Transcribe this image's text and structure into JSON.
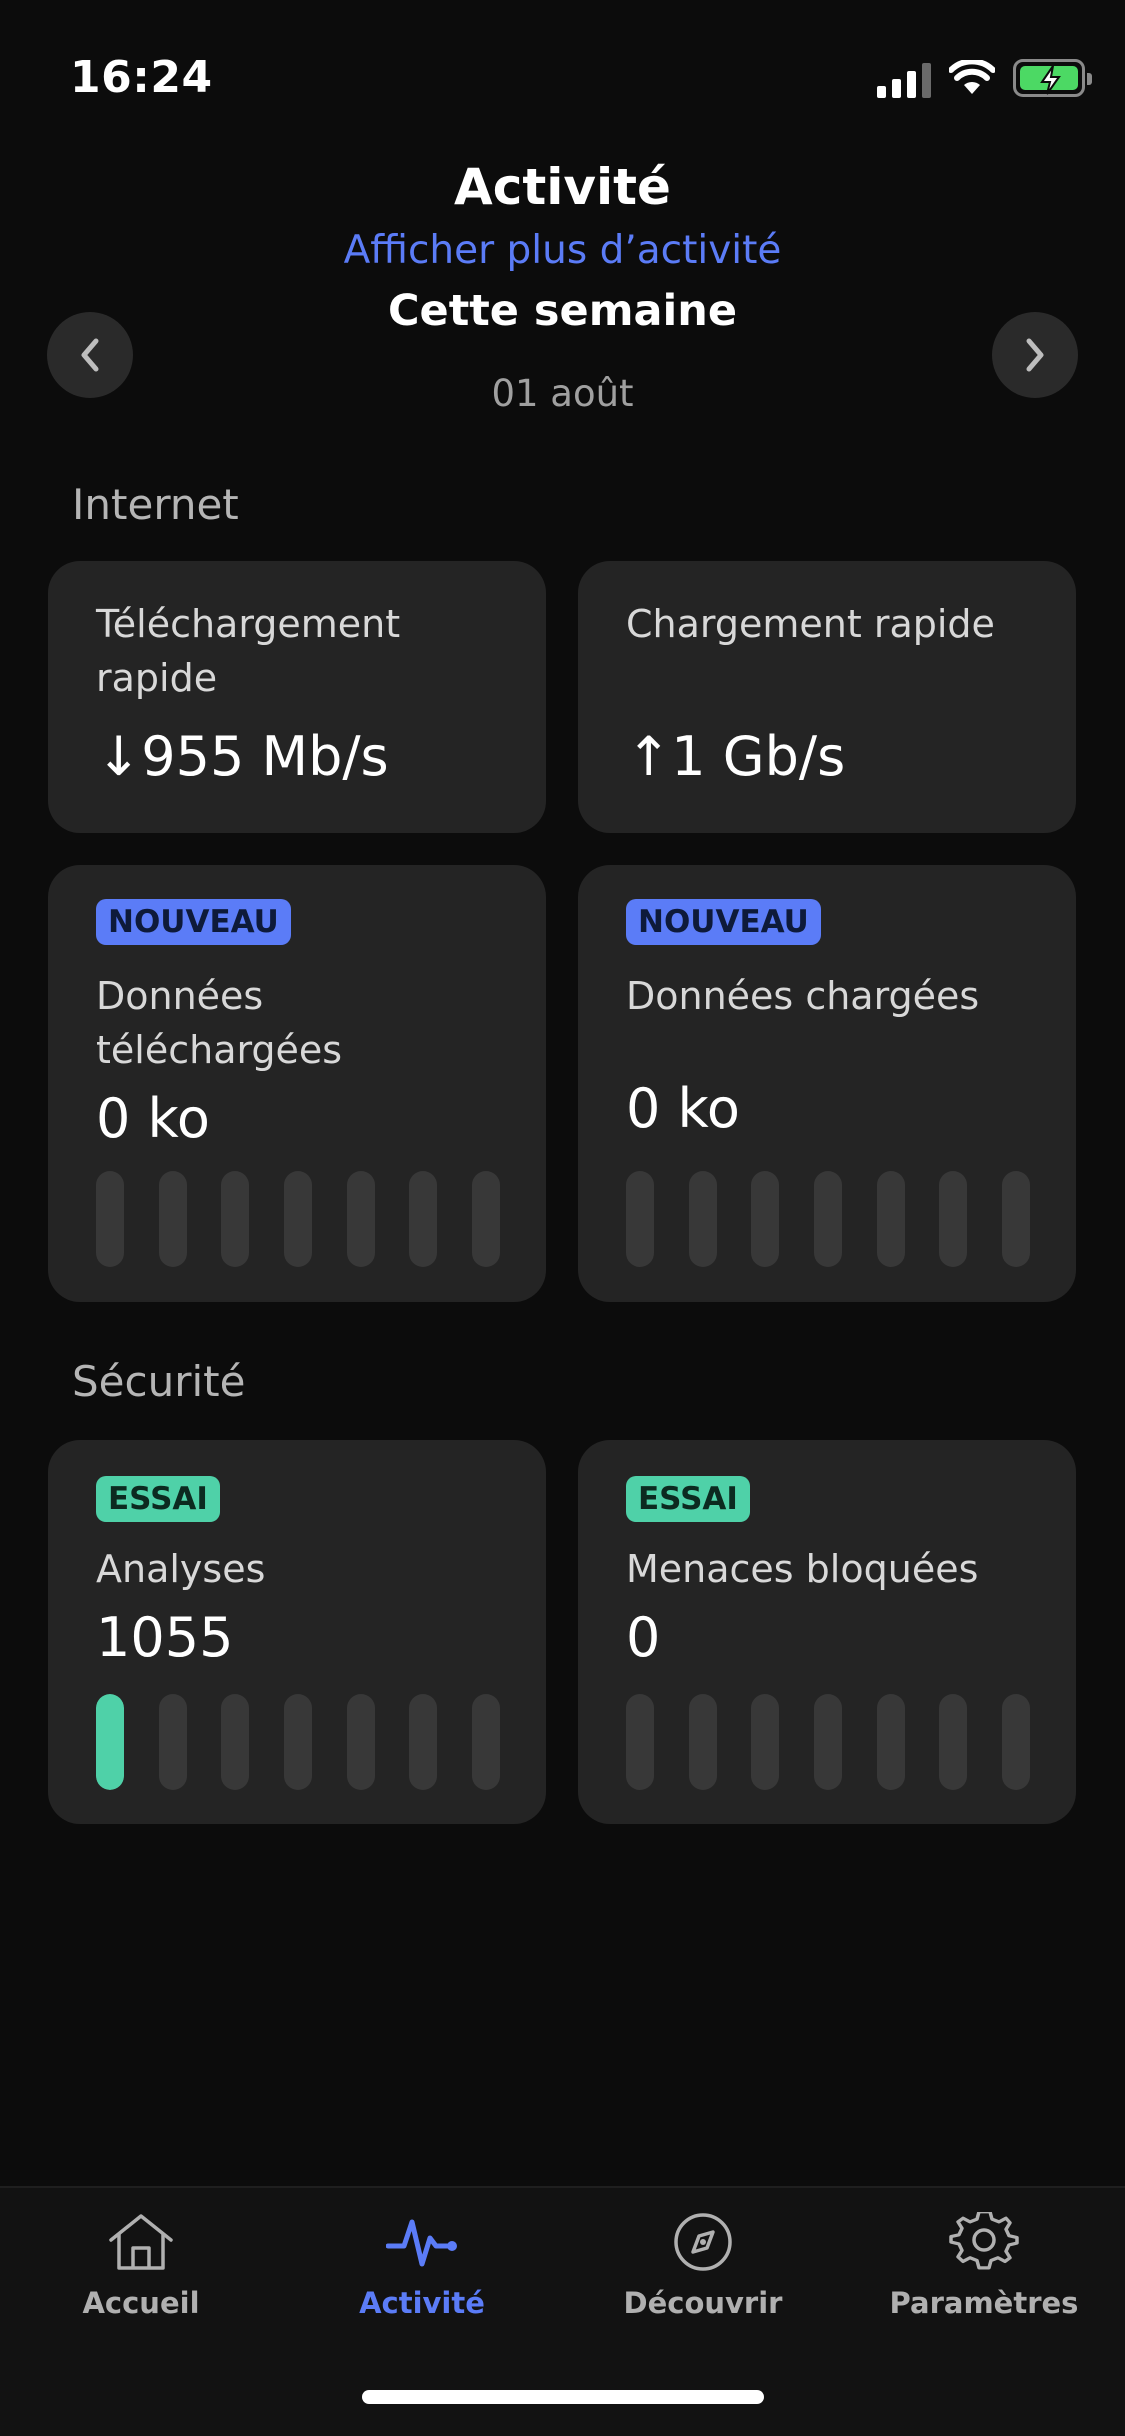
{
  "status_bar": {
    "time": "16:24"
  },
  "header": {
    "title": "Activité",
    "more_link": "Afficher plus d’activité",
    "period": "Cette semaine",
    "date": "01 août"
  },
  "internet": {
    "section_label": "Internet",
    "download_speed": {
      "title": "Téléchargement rapide",
      "value": "↓955 Mb/s"
    },
    "upload_speed": {
      "title": "Chargement rapide",
      "value": "↑1 Gb/s"
    },
    "downloaded_data": {
      "badge": "NOUVEAU",
      "title": "Données téléchargées",
      "value": "0 ko",
      "daily_levels": [
        0,
        0,
        0,
        0,
        0,
        0,
        0
      ]
    },
    "uploaded_data": {
      "badge": "NOUVEAU",
      "title": "Données chargées",
      "value": "0 ko",
      "daily_levels": [
        0,
        0,
        0,
        0,
        0,
        0,
        0
      ]
    }
  },
  "security": {
    "section_label": "Sécurité",
    "scans": {
      "badge": "ESSAI",
      "title": "Analyses",
      "value": "1055",
      "daily_levels": [
        1,
        0,
        0,
        0,
        0,
        0,
        0
      ]
    },
    "threats_blocked": {
      "badge": "ESSAI",
      "title": "Menaces bloquées",
      "value": "0",
      "daily_levels": [
        0,
        0,
        0,
        0,
        0,
        0,
        0
      ]
    }
  },
  "tab_bar": {
    "tabs": [
      {
        "label": "Accueil",
        "icon": "home-icon"
      },
      {
        "label": "Activité",
        "icon": "activity-icon"
      },
      {
        "label": "Découvrir",
        "icon": "compass-icon"
      },
      {
        "label": "Paramètres",
        "icon": "gear-icon"
      }
    ],
    "active_index": 1
  },
  "colors": {
    "accent": "#5b7cf7",
    "trial": "#4fd1a8",
    "card": "#242424",
    "background": "#0c0c0c"
  }
}
